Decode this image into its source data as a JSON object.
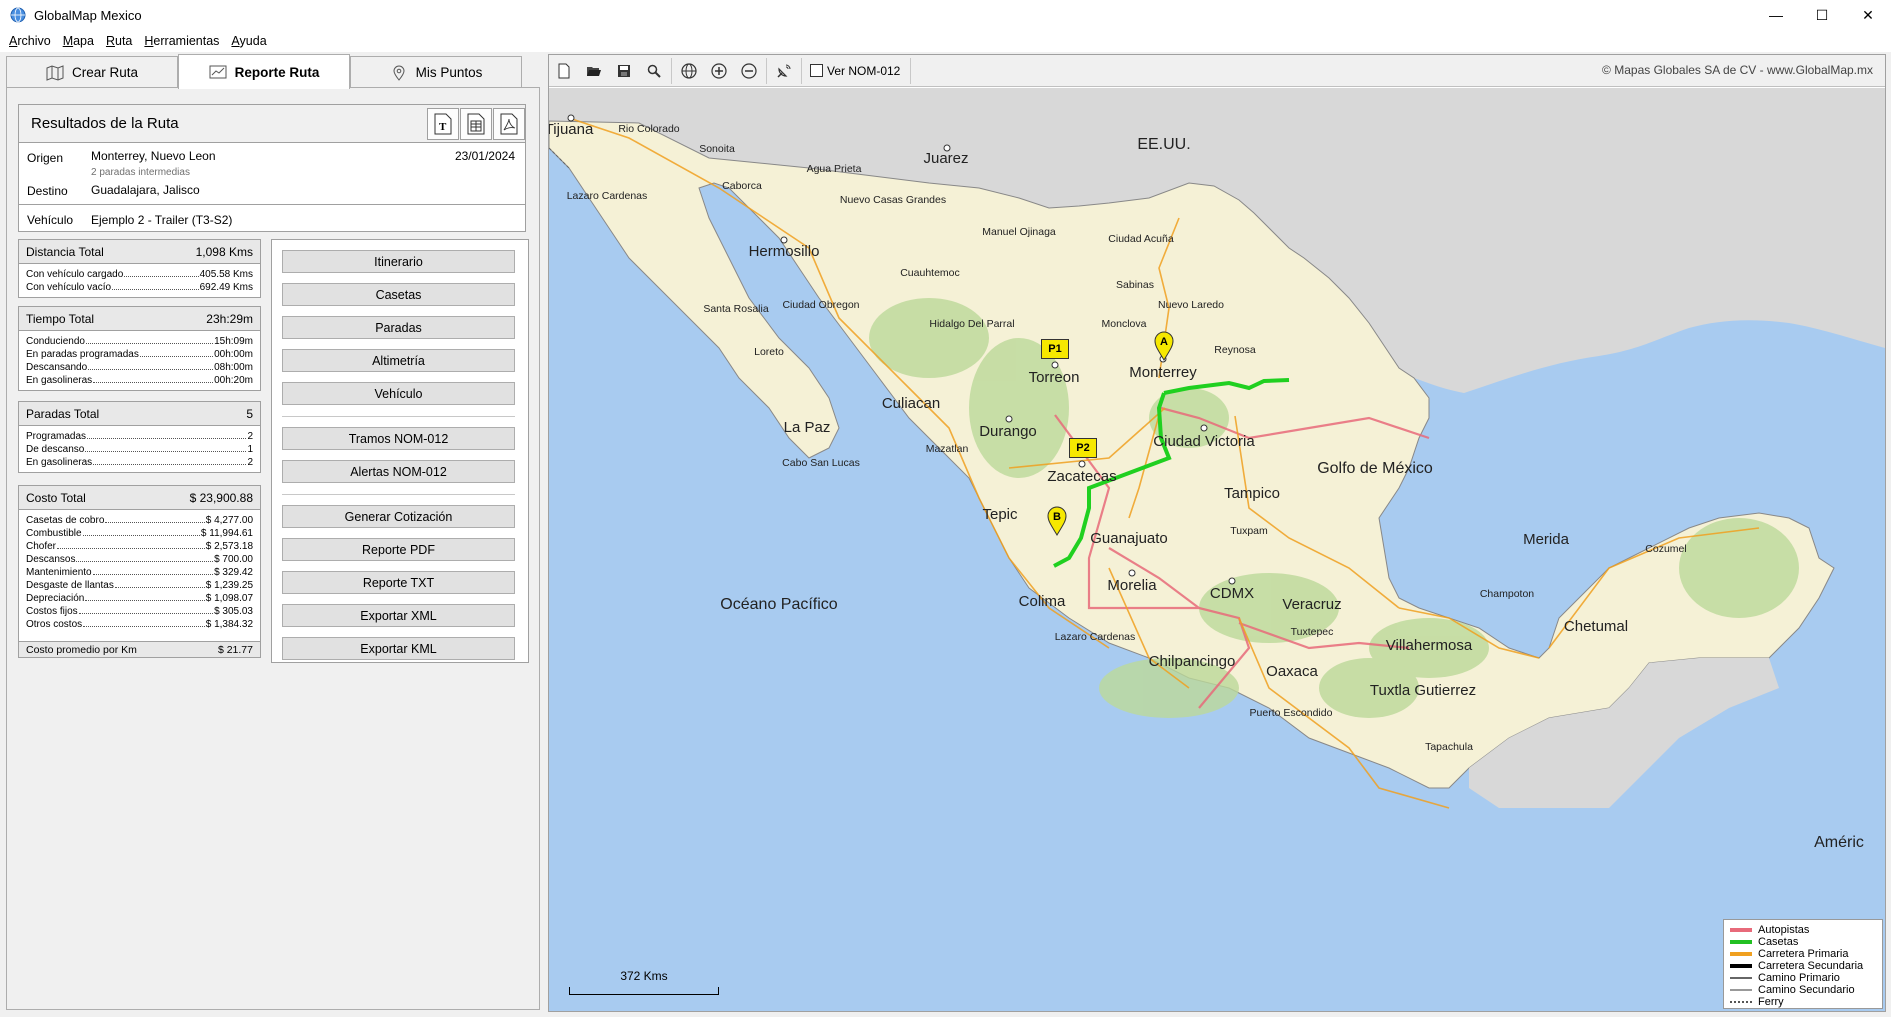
{
  "window": {
    "title": "GlobalMap Mexico",
    "controls": {
      "minimize": "—",
      "maximize": "☐",
      "close": "✕"
    }
  },
  "menu": [
    {
      "label": "Archivo",
      "accel": "A",
      "rest": "rchivo"
    },
    {
      "label": "Mapa",
      "accel": "M",
      "rest": "apa"
    },
    {
      "label": "Ruta",
      "accel": "R",
      "rest": "uta"
    },
    {
      "label": "Herramientas",
      "accel": "H",
      "rest": "erramientas"
    },
    {
      "label": "Ayuda",
      "accel": "A",
      "rest": "yuda"
    }
  ],
  "tabs": {
    "crear": "Crear Ruta",
    "reporte": "Reporte Ruta",
    "puntos": "Mis Puntos"
  },
  "results": {
    "title": "Resultados de la Ruta",
    "origin_label": "Origen",
    "origin_value": "Monterrey, Nuevo Leon",
    "stops_note": "2 paradas intermedias",
    "date": "23/01/2024",
    "dest_label": "Destino",
    "dest_value": "Guadalajara, Jalisco",
    "vehicle_label": "Vehículo",
    "vehicle_value": "Ejemplo 2 - Trailer (T3-S2)"
  },
  "distance": {
    "title": "Distancia Total",
    "total": "1,098 Kms",
    "rows": [
      {
        "label": "Con vehículo cargado",
        "value": "405.58 Kms"
      },
      {
        "label": "Con vehículo vacío",
        "value": "692.49 Kms"
      }
    ]
  },
  "time": {
    "title": "Tiempo Total",
    "total": "23h:29m",
    "rows": [
      {
        "label": "Conduciendo",
        "value": "15h:09m"
      },
      {
        "label": "En paradas programadas",
        "value": "00h:00m"
      },
      {
        "label": "Descansando",
        "value": "08h:00m"
      },
      {
        "label": "En gasolineras",
        "value": "00h:20m"
      }
    ]
  },
  "stops": {
    "title": "Paradas Total",
    "total": "5",
    "rows": [
      {
        "label": "Programadas",
        "value": "2"
      },
      {
        "label": "De descanso",
        "value": "1"
      },
      {
        "label": "En gasolineras",
        "value": "2"
      }
    ]
  },
  "cost": {
    "title": "Costo Total",
    "total": "$ 23,900.88",
    "rows": [
      {
        "label": "Casetas de cobro",
        "value": "$ 4,277.00"
      },
      {
        "label": "Combustible",
        "value": "$ 11,994.61"
      },
      {
        "label": "Chofer",
        "value": "$ 2,573.18"
      },
      {
        "label": "Descansos",
        "value": "$ 700.00"
      },
      {
        "label": "Mantenimiento",
        "value": "$ 329.42"
      },
      {
        "label": "Desgaste de llantas",
        "value": "$ 1,239.25"
      },
      {
        "label": "Depreciación",
        "value": "$ 1,098.07"
      },
      {
        "label": "Costos fijos",
        "value": "$ 305.03"
      },
      {
        "label": "Otros costos",
        "value": "$ 1,384.32"
      }
    ],
    "avg_label": "Costo promedio por Km",
    "avg_value": "$ 21.77"
  },
  "buttons": {
    "group1": [
      "Itinerario",
      "Casetas",
      "Paradas",
      "Altimetría",
      "Vehículo"
    ],
    "group2": [
      "Tramos NOM-012",
      "Alertas NOM-012"
    ],
    "group3": [
      "Generar Cotización",
      "Reporte PDF",
      "Reporte TXT",
      "Exportar XML",
      "Exportar KML"
    ]
  },
  "map": {
    "nom_checkbox": "Ver NOM-012",
    "nom_checked": false,
    "copyright": "© Mapas Globales SA de CV - www.GlobalMap.mx",
    "scale": "372 Kms",
    "markers": {
      "p1": "P1",
      "p2": "P2",
      "a": "A",
      "b": "B"
    },
    "seas": [
      "EE.UU.",
      "Golfo de México",
      "Océano Pacífico",
      "Améric"
    ],
    "cities_big": [
      "Tijuana",
      "Juarez",
      "Hermosillo",
      "Torreon",
      "Monterrey",
      "Culiacan",
      "La Paz",
      "Durango",
      "Zacatecas",
      "Ciudad Victoria",
      "Tampico",
      "Tepic",
      "Guanajuato",
      "Morelia",
      "CDMX",
      "Colima",
      "Veracruz",
      "Villahermosa",
      "Merida",
      "Chetumal",
      "Oaxaca",
      "Chilpancingo",
      "Tuxtla Gutierrez"
    ],
    "cities_small": [
      "Rio Colorado",
      "Sonoita",
      "Agua Prieta",
      "Caborca",
      "Nuevo Casas Grandes",
      "Lazaro Cardenas",
      "Manuel Ojinaga",
      "Ciudad Acuña",
      "Cuauhtemoc",
      "Sabinas",
      "Nuevo Laredo",
      "Santa Rosalia",
      "Ciudad Obregon",
      "Hidalgo Del Parral",
      "Monclova",
      "Reynosa",
      "Loreto",
      "Mazatlan",
      "Cabo San Lucas",
      "Tuxpam",
      "Lazaro Cardenas",
      "Champoton",
      "Cozumel",
      "Tuxtepec",
      "Puerto Escondido",
      "Tapachula"
    ],
    "legend": [
      {
        "label": "Autopistas",
        "color": "#e86a7a"
      },
      {
        "label": "Casetas",
        "color": "#22c022"
      },
      {
        "label": "Carretera Primaria",
        "color": "#f0a020"
      },
      {
        "label": "Carretera Secundaria",
        "color": "#000000"
      },
      {
        "label": "Camino Primario",
        "color": "#666666"
      },
      {
        "label": "Camino Secundario",
        "color": "#999999"
      },
      {
        "label": "Ferry",
        "color": "#555555"
      }
    ]
  }
}
